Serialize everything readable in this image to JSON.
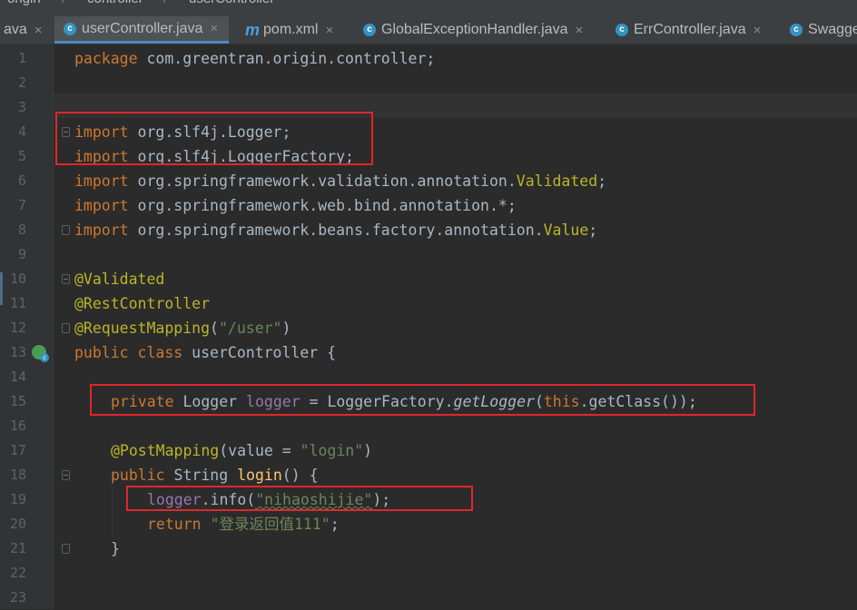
{
  "breadcrumb": {
    "items": [
      "origin",
      "controller",
      "userController"
    ]
  },
  "tabs": [
    {
      "label": "ava",
      "icon": "none",
      "closable": true
    },
    {
      "label": "userController.java",
      "icon": "java-class-icon",
      "active": true,
      "closable": true
    },
    {
      "label": "pom.xml",
      "icon": "maven-icon",
      "icon_glyph": "m",
      "closable": true
    },
    {
      "label": "GlobalExceptionHandler.java",
      "icon": "java-class-icon",
      "closable": true
    },
    {
      "label": "ErrController.java",
      "icon": "java-class-icon",
      "closable": true
    },
    {
      "label": "Swagge",
      "icon": "java-class-icon",
      "closable": false
    }
  ],
  "icons": {
    "class_glyph": "c",
    "close_glyph": "×"
  },
  "line_numbers": [
    "1",
    "2",
    "3",
    "4",
    "5",
    "6",
    "7",
    "8",
    "9",
    "10",
    "11",
    "12",
    "13",
    "14",
    "15",
    "16",
    "17",
    "18",
    "19",
    "20",
    "21",
    "22",
    "23"
  ],
  "code": {
    "l1": {
      "kw": "package",
      "rest": " com.greentran.origin.controller;"
    },
    "l4": {
      "kw": "import",
      "rest": " org.slf4j.Logger;"
    },
    "l5": {
      "kw": "import",
      "rest": " org.slf4j.LoggerFactory;"
    },
    "l6": {
      "kw": "import",
      "rest": " org.springframework.validation.annotation.",
      "ann": "Validated",
      "end": ";"
    },
    "l7": {
      "kw": "import",
      "rest": " org.springframework.web.bind.annotation.*;"
    },
    "l8": {
      "kw": "import",
      "rest": " org.springframework.beans.factory.annotation.",
      "ann": "Value",
      "end": ";"
    },
    "l10": {
      "ann": "@Validated"
    },
    "l11": {
      "ann": "@RestController"
    },
    "l12": {
      "ann": "@RequestMapping",
      "open": "(",
      "str": "\"/user\"",
      "close": ")"
    },
    "l13": {
      "kw1": "public",
      "kw2": "class",
      "rest": " userController {"
    },
    "l15": {
      "kw": "private",
      "type": " Logger ",
      "fld": "logger",
      "eq": " = LoggerFactory.",
      "mth": "getLogger",
      "open": "(",
      "kw2": "this",
      "rest": ".getClass());"
    },
    "l17": {
      "ann": "@PostMapping",
      "open": "(value = ",
      "str": "\"login\"",
      "close": ")"
    },
    "l18": {
      "kw": "public",
      "type": " String ",
      "mth": "login",
      "rest": "() {"
    },
    "l19": {
      "fld": "logger",
      "mid": ".info(",
      "str": "\"nihaoshijie\"",
      "end": ");"
    },
    "l20": {
      "kw": "return",
      "str": "\"登录返回值111\"",
      "end": ";"
    },
    "l21": {
      "text": "}"
    }
  },
  "colors": {
    "keyword": "#cc7832",
    "annotation": "#bbb529",
    "string": "#6a8759",
    "field": "#9876aa",
    "method": "#ffc66d",
    "default": "#a9b7c6",
    "highlight_box": "#e0262d"
  }
}
